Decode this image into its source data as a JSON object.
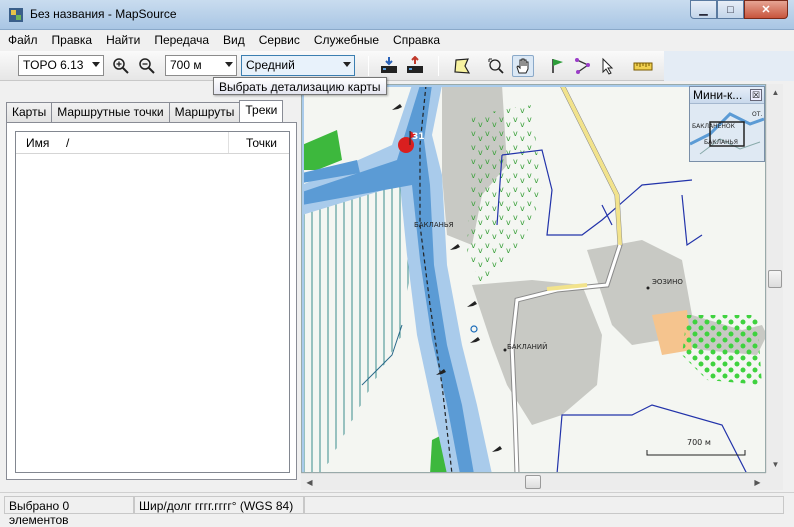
{
  "window": {
    "title": "Без названия - MapSource",
    "buttons": {
      "minimize": "▁",
      "maximize": "□",
      "close": "✕"
    }
  },
  "menu": [
    "Файл",
    "Правка",
    "Найти",
    "Передача",
    "Вид",
    "Сервис",
    "Служебные",
    "Справка"
  ],
  "toolbar": {
    "map_product": "TOPO 6.13",
    "zoom_level": "700 м",
    "detail_level": "Средний",
    "tooltip": "Выбрать детализацию карты"
  },
  "tabs": [
    "Карты",
    "Маршрутные точки",
    "Маршруты",
    "Треки"
  ],
  "active_tab": "Треки",
  "list": {
    "columns": [
      "Имя",
      "/",
      "Точки"
    ]
  },
  "map": {
    "labels": {
      "bakl1": "БАКЛАНЬЯ",
      "ezino": "ЭОЗИНО",
      "bakl2": "БАКЛАНИЙ",
      "route_num": "31"
    },
    "scale_label": "700 м"
  },
  "minimap": {
    "title": "Мини-к...",
    "close": "☒",
    "label1": "БАКЛАНЁНОК",
    "label2": "БАКЛАНЬЯ",
    "label3": "ОТ."
  },
  "status": {
    "selected": "Выбрано 0 элементов",
    "coords": "Шир/долг гггг.гггг° (WGS 84)"
  },
  "colors": {
    "water": "#5b9bd5",
    "water_light": "#a9cbeb",
    "forest_green": "#3db83d",
    "gray_area": "#c8c9c4",
    "road_yellow": "#f2e38c",
    "peach": "#f5c48e"
  }
}
